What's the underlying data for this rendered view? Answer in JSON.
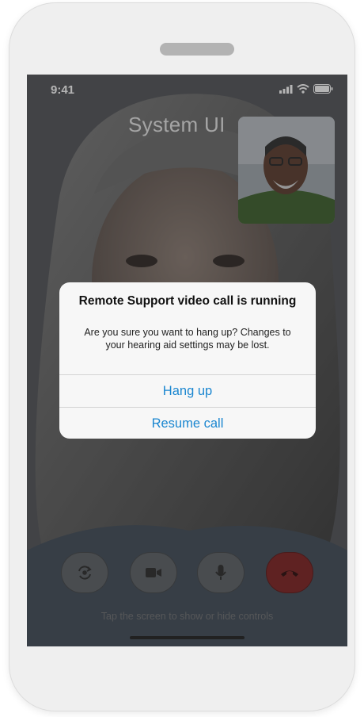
{
  "status_bar": {
    "time": "9:41",
    "icons": [
      "signal-icon",
      "wifi-icon",
      "battery-icon"
    ]
  },
  "screen": {
    "title": "System UI",
    "hint": "Tap the screen to show or hide controls"
  },
  "controls": [
    {
      "name": "switch-camera-button",
      "icon": "camera-rotate-icon"
    },
    {
      "name": "video-button",
      "icon": "video-camera-icon"
    },
    {
      "name": "microphone-button",
      "icon": "microphone-icon"
    },
    {
      "name": "end-call-button",
      "icon": "phone-hangup-icon",
      "color": "#7d2020"
    }
  ],
  "dialog": {
    "title": "Remote Support video call is running",
    "message": "Are you sure you want to hang up? Changes to your hearing aid settings may be lost.",
    "primary_action": "Hang up",
    "secondary_action": "Resume call",
    "accent": "#1a86d0"
  }
}
